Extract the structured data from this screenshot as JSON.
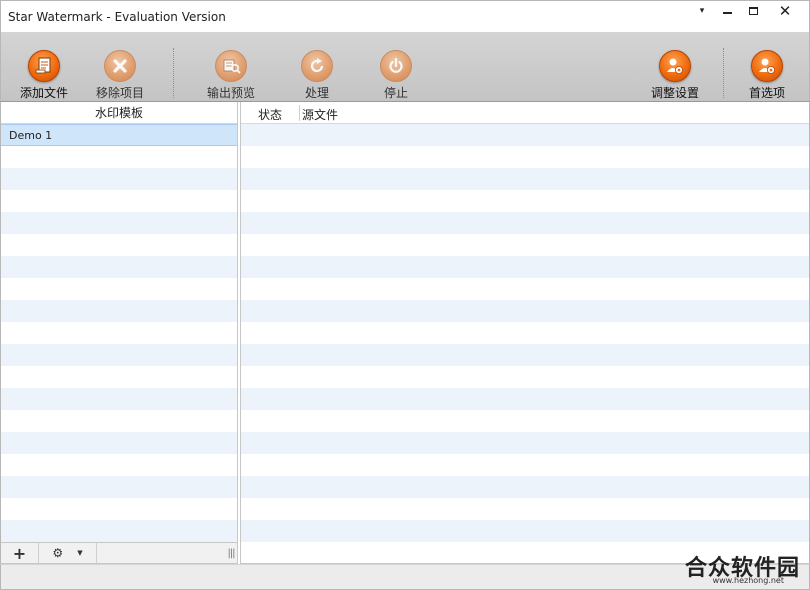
{
  "window": {
    "title": "Star Watermark - Evaluation Version",
    "controls": {
      "menu": "▾",
      "close": "✕"
    }
  },
  "toolbar": {
    "add_file": "添加文件",
    "remove_item": "移除项目",
    "output_preview": "输出预览",
    "process": "处理",
    "stop": "停止",
    "adjust_settings": "调整设置",
    "preferences": "首选项"
  },
  "left_panel": {
    "header": "水印模板",
    "templates": [
      "Demo 1"
    ],
    "footer": {
      "add": "+",
      "gear": "⚙",
      "caret": "▼",
      "grip": "|||"
    }
  },
  "right_panel": {
    "columns": [
      "状态",
      "源文件"
    ]
  },
  "watermark": {
    "main": "合众软件园",
    "sub": "www.hezhong.net"
  },
  "colors": {
    "accent_orange": "#f06b0f",
    "row_alt": "#ecf3fb",
    "row_selected": "#cfe5fa",
    "toolbar_bg": "#c8c8c8"
  },
  "icons": {
    "add_file": "add-file-icon",
    "remove_item": "remove-icon",
    "output_preview": "preview-icon",
    "process": "process-icon",
    "stop": "stop-icon",
    "adjust_settings": "user-settings-icon",
    "preferences": "preferences-icon"
  }
}
